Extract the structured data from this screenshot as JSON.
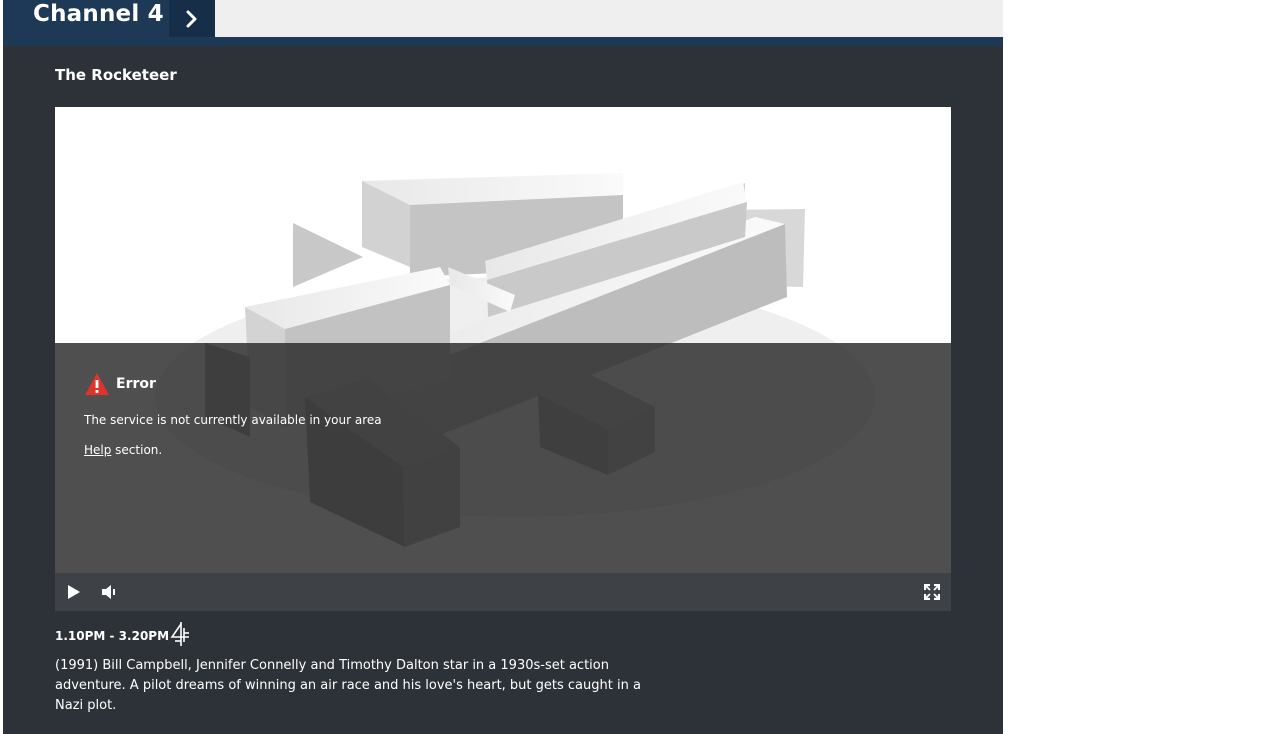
{
  "header": {
    "channel_name": "Channel 4",
    "next_icon": "chevron-right-icon"
  },
  "programme": {
    "title": "The Rocketeer"
  },
  "player": {
    "error": {
      "icon": "warning-triangle-icon",
      "title": "Error",
      "message": "The service is not currently available in your area",
      "help_link": "Help",
      "help_suffix": " section."
    },
    "controls": {
      "play_icon": "play-icon",
      "volume_icon": "volume-icon",
      "fullscreen_icon": "fullscreen-icon"
    }
  },
  "schedule": {
    "time": "1.10PM - 3.20PM",
    "channel_logo": "channel-4-logo-icon"
  },
  "description": "(1991) Bill Campbell, Jennifer Connelly and Timothy Dalton star in a 1930s-set action adventure. A pilot dreams of winning an air race and his love's heart, but gets caught in a Nazi plot.",
  "colors": {
    "page_bg": "#2d3239",
    "header_blue": "#1d3955",
    "error_red": "#e0332b"
  }
}
